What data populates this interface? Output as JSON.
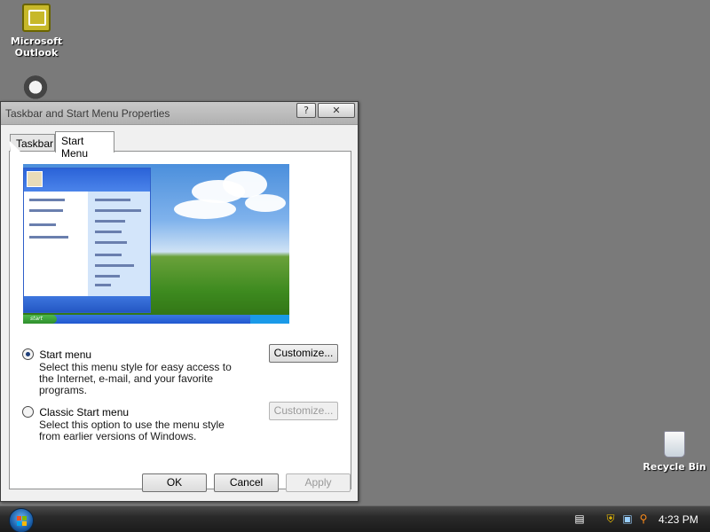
{
  "desktop": {
    "icons": [
      {
        "label": "Microsoft Outlook"
      },
      {
        "label": ""
      },
      {
        "label": "Recycle Bin"
      }
    ]
  },
  "dialog": {
    "title": "Taskbar and Start Menu Properties",
    "help_glyph": "?",
    "close_glyph": "✕",
    "tabs": [
      {
        "label": "Taskbar",
        "selected": false
      },
      {
        "label": "Start Menu",
        "selected": true
      }
    ],
    "preview": {
      "start_label": "start"
    },
    "options": [
      {
        "label": "Start menu",
        "checked": true,
        "description": "Select this menu style for easy access to the Internet, e-mail, and your favorite programs.",
        "button": "Customize...",
        "button_enabled": true
      },
      {
        "label": "Classic Start menu",
        "checked": false,
        "description": "Select this option to use the menu style from earlier versions of Windows.",
        "button": "Customize...",
        "button_enabled": false
      }
    ],
    "buttons": {
      "ok": "OK",
      "cancel": "Cancel",
      "apply": "Apply"
    }
  },
  "taskbar": {
    "clock": "4:23 PM",
    "tray_icons": [
      "keyboard-icon",
      "security-shield-icon",
      "network-icon",
      "search-icon"
    ]
  },
  "colors": {
    "desktop_bg": "#7a7a7a",
    "taskbar_bg": "#1b1b1b",
    "orb_blue": "#1a5ea8"
  }
}
